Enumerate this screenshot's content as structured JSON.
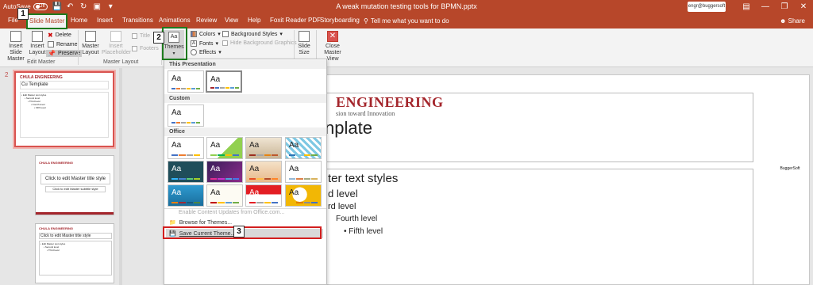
{
  "titlebar": {
    "autosave_label": "AutoSave",
    "autosave_state": "Off",
    "doc_title": "A weak mutation testing tools for BPMN.pptx",
    "account_label": "engr@buggersoft"
  },
  "tabs": [
    "File",
    "Slide Master",
    "Home",
    "Insert",
    "Transitions",
    "Animations",
    "Review",
    "View",
    "Help",
    "Foxit Reader PDF",
    "Storyboarding"
  ],
  "tell_me": "Tell me what you want to do",
  "share": "Share",
  "ribbon": {
    "insert_slide_master": [
      "Insert Slide",
      "Master"
    ],
    "insert_layout": [
      "Insert",
      "Layout"
    ],
    "delete": "Delete",
    "rename": "Rename",
    "preserve": "Preserve",
    "edit_master_group": "Edit Master",
    "master_layout": [
      "Master",
      "Layout"
    ],
    "insert_placeholder": [
      "Insert",
      "Placeholder"
    ],
    "title": "Title",
    "footers": "Footers",
    "master_layout_group": "Master Layout",
    "themes": "Themes",
    "colors": "Colors",
    "fonts": "Fonts",
    "effects": "Effects",
    "background_styles": "Background Styles",
    "hide_background": "Hide Background Graphics",
    "slide_size": [
      "Slide",
      "Size"
    ],
    "close_master_view": [
      "Close",
      "Master View"
    ]
  },
  "themes_menu": {
    "section_this_presentation": "This Presentation",
    "section_custom": "Custom",
    "section_office": "Office",
    "tile_text": "Aa",
    "enable_updates": "Enable Content Updates from Office.com...",
    "browse": "Browse for Themes...",
    "save_current": "Save Current Theme..."
  },
  "thumbnails": {
    "slide_number": "2",
    "master": {
      "logo": "CHULA ENGINEERING",
      "title": "Cu Template",
      "lines": [
        "• Edit Master text styles",
        "• Second level",
        "• Third level",
        "• Fourth level",
        "• Fifth level"
      ]
    },
    "layout1": {
      "title": "Click to edit Master title style",
      "subtitle": "Click to edit Master subtitle style"
    },
    "layout2": {
      "title": "Click to edit Master title style",
      "lines": [
        "• Edit Master text styles",
        "• Second level",
        "• Third level"
      ]
    }
  },
  "slide": {
    "logo": "ENGINEERING",
    "tagline": "sion toward Innovation",
    "title": "nplate",
    "levels": [
      "ter text styles",
      "d level",
      "rd level",
      "Fourth level",
      "• Fifth level"
    ],
    "badge": "BuggerSoft"
  },
  "callouts": [
    "1",
    "2",
    "3"
  ],
  "colors": {
    "accent": "#b7472a",
    "highlight_green": "#1e7a1e",
    "highlight_red": "#d21f1f"
  }
}
